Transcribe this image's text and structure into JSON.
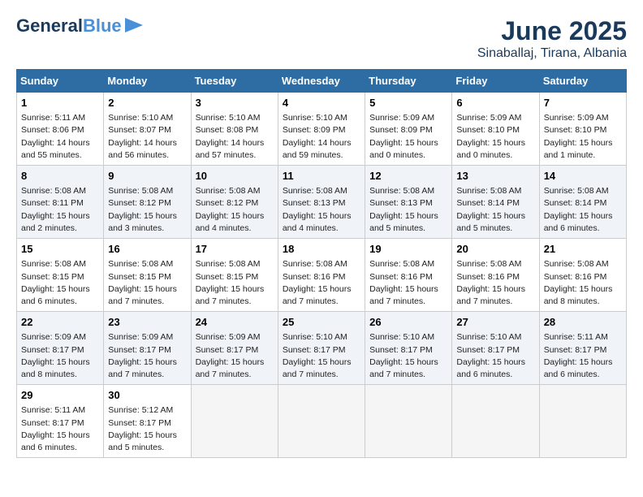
{
  "header": {
    "logo_line1": "General",
    "logo_line2": "Blue",
    "month": "June 2025",
    "location": "Sinaballaj, Tirana, Albania"
  },
  "days_of_week": [
    "Sunday",
    "Monday",
    "Tuesday",
    "Wednesday",
    "Thursday",
    "Friday",
    "Saturday"
  ],
  "weeks": [
    [
      {
        "num": "1",
        "info": "Sunrise: 5:11 AM\nSunset: 8:06 PM\nDaylight: 14 hours\nand 55 minutes."
      },
      {
        "num": "2",
        "info": "Sunrise: 5:10 AM\nSunset: 8:07 PM\nDaylight: 14 hours\nand 56 minutes."
      },
      {
        "num": "3",
        "info": "Sunrise: 5:10 AM\nSunset: 8:08 PM\nDaylight: 14 hours\nand 57 minutes."
      },
      {
        "num": "4",
        "info": "Sunrise: 5:10 AM\nSunset: 8:09 PM\nDaylight: 14 hours\nand 59 minutes."
      },
      {
        "num": "5",
        "info": "Sunrise: 5:09 AM\nSunset: 8:09 PM\nDaylight: 15 hours\nand 0 minutes."
      },
      {
        "num": "6",
        "info": "Sunrise: 5:09 AM\nSunset: 8:10 PM\nDaylight: 15 hours\nand 0 minutes."
      },
      {
        "num": "7",
        "info": "Sunrise: 5:09 AM\nSunset: 8:10 PM\nDaylight: 15 hours\nand 1 minute."
      }
    ],
    [
      {
        "num": "8",
        "info": "Sunrise: 5:08 AM\nSunset: 8:11 PM\nDaylight: 15 hours\nand 2 minutes."
      },
      {
        "num": "9",
        "info": "Sunrise: 5:08 AM\nSunset: 8:12 PM\nDaylight: 15 hours\nand 3 minutes."
      },
      {
        "num": "10",
        "info": "Sunrise: 5:08 AM\nSunset: 8:12 PM\nDaylight: 15 hours\nand 4 minutes."
      },
      {
        "num": "11",
        "info": "Sunrise: 5:08 AM\nSunset: 8:13 PM\nDaylight: 15 hours\nand 4 minutes."
      },
      {
        "num": "12",
        "info": "Sunrise: 5:08 AM\nSunset: 8:13 PM\nDaylight: 15 hours\nand 5 minutes."
      },
      {
        "num": "13",
        "info": "Sunrise: 5:08 AM\nSunset: 8:14 PM\nDaylight: 15 hours\nand 5 minutes."
      },
      {
        "num": "14",
        "info": "Sunrise: 5:08 AM\nSunset: 8:14 PM\nDaylight: 15 hours\nand 6 minutes."
      }
    ],
    [
      {
        "num": "15",
        "info": "Sunrise: 5:08 AM\nSunset: 8:15 PM\nDaylight: 15 hours\nand 6 minutes."
      },
      {
        "num": "16",
        "info": "Sunrise: 5:08 AM\nSunset: 8:15 PM\nDaylight: 15 hours\nand 7 minutes."
      },
      {
        "num": "17",
        "info": "Sunrise: 5:08 AM\nSunset: 8:15 PM\nDaylight: 15 hours\nand 7 minutes."
      },
      {
        "num": "18",
        "info": "Sunrise: 5:08 AM\nSunset: 8:16 PM\nDaylight: 15 hours\nand 7 minutes."
      },
      {
        "num": "19",
        "info": "Sunrise: 5:08 AM\nSunset: 8:16 PM\nDaylight: 15 hours\nand 7 minutes."
      },
      {
        "num": "20",
        "info": "Sunrise: 5:08 AM\nSunset: 8:16 PM\nDaylight: 15 hours\nand 7 minutes."
      },
      {
        "num": "21",
        "info": "Sunrise: 5:08 AM\nSunset: 8:16 PM\nDaylight: 15 hours\nand 8 minutes."
      }
    ],
    [
      {
        "num": "22",
        "info": "Sunrise: 5:09 AM\nSunset: 8:17 PM\nDaylight: 15 hours\nand 8 minutes."
      },
      {
        "num": "23",
        "info": "Sunrise: 5:09 AM\nSunset: 8:17 PM\nDaylight: 15 hours\nand 7 minutes."
      },
      {
        "num": "24",
        "info": "Sunrise: 5:09 AM\nSunset: 8:17 PM\nDaylight: 15 hours\nand 7 minutes."
      },
      {
        "num": "25",
        "info": "Sunrise: 5:10 AM\nSunset: 8:17 PM\nDaylight: 15 hours\nand 7 minutes."
      },
      {
        "num": "26",
        "info": "Sunrise: 5:10 AM\nSunset: 8:17 PM\nDaylight: 15 hours\nand 7 minutes."
      },
      {
        "num": "27",
        "info": "Sunrise: 5:10 AM\nSunset: 8:17 PM\nDaylight: 15 hours\nand 6 minutes."
      },
      {
        "num": "28",
        "info": "Sunrise: 5:11 AM\nSunset: 8:17 PM\nDaylight: 15 hours\nand 6 minutes."
      }
    ],
    [
      {
        "num": "29",
        "info": "Sunrise: 5:11 AM\nSunset: 8:17 PM\nDaylight: 15 hours\nand 6 minutes."
      },
      {
        "num": "30",
        "info": "Sunrise: 5:12 AM\nSunset: 8:17 PM\nDaylight: 15 hours\nand 5 minutes."
      },
      {
        "num": "",
        "info": ""
      },
      {
        "num": "",
        "info": ""
      },
      {
        "num": "",
        "info": ""
      },
      {
        "num": "",
        "info": ""
      },
      {
        "num": "",
        "info": ""
      }
    ]
  ]
}
